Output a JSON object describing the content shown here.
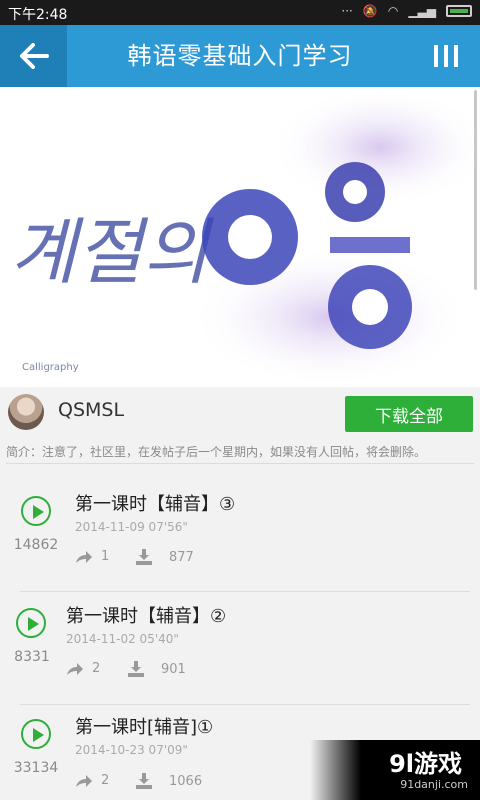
{
  "status": {
    "time": "下午2:48"
  },
  "appbar": {
    "title": "韩语零基础入门学习",
    "back_icon": "arrow-left-icon",
    "menu_icon": "menu-bars-icon"
  },
  "banner": {
    "caption": "Calligraphy"
  },
  "author": {
    "name": "QSMSL",
    "download_all": "下载全部"
  },
  "intro": "简介：注意了，社区里，在发帖子后一个星期内，如果没有人回帖，将会删除。",
  "lessons": [
    {
      "title": "第一课时【辅音】③",
      "date": "2014-11-09 07'56\"",
      "plays": "14862",
      "shares": "1",
      "downloads": "877"
    },
    {
      "title": "第一课时【辅音】②",
      "date": "2014-11-02 05'40\"",
      "plays": "8331",
      "shares": "2",
      "downloads": "901"
    },
    {
      "title": "第一课时[辅音]①",
      "date": "2014-10-23 07'09\"",
      "plays": "33134",
      "shares": "2",
      "downloads": "1066"
    }
  ],
  "watermark": {
    "logo": "9l游戏",
    "url": "91danji.com"
  },
  "colors": {
    "accent": "#2d9ad6",
    "green": "#2eaf3a"
  }
}
